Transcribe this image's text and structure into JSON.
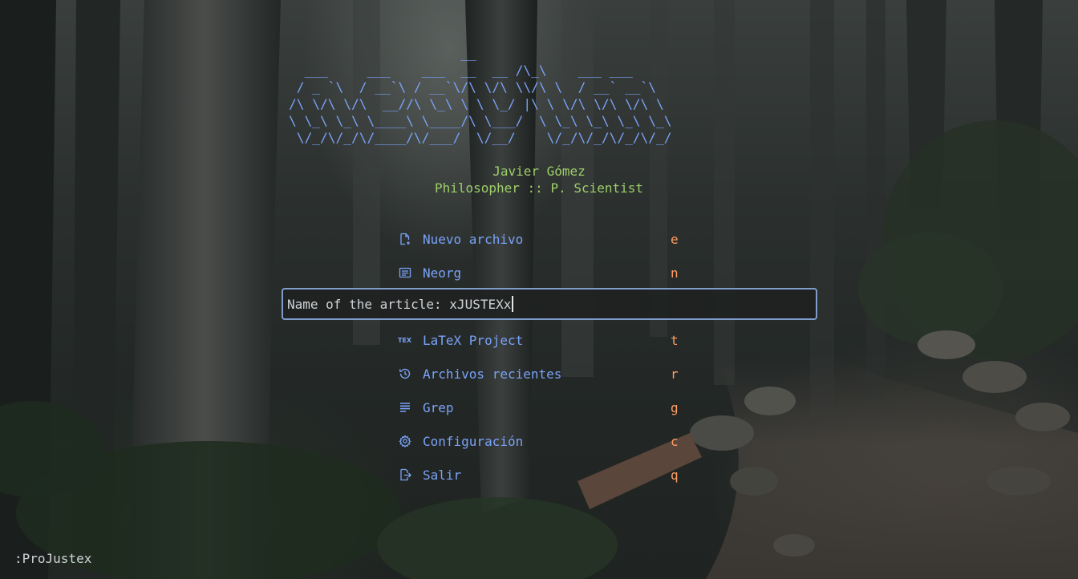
{
  "banner": {
    "art": "                      __\n  ___     ___    ___  __  __ /\\_\\    ___ ___\n / _ `\\  / __`\\ / __`\\/\\ \\/\\ \\\\/\\ \\  / __` __`\\\n/\\ \\/\\ \\/\\  __//\\ \\_\\ \\ \\ \\_/ |\\ \\ \\/\\ \\/\\ \\/\\ \\\n\\ \\_\\ \\_\\ \\____\\ \\____/\\ \\___/  \\ \\_\\ \\_\\ \\_\\ \\_\\\n \\/_/\\/_/\\/____/\\/___/  \\/__/    \\/_/\\/_/\\/_/\\/_/"
  },
  "header": {
    "name": "Javier Gómez",
    "subtitle": "Philosopher :: P. Scientist"
  },
  "menu": [
    {
      "label": "Nuevo archivo",
      "key": "e",
      "icon": "new-file-icon"
    },
    {
      "label": "Neorg",
      "key": "n",
      "icon": "note-icon"
    },
    {
      "label": "LaTeX Project",
      "key": "t",
      "icon": "tex-icon"
    },
    {
      "label": "Archivos recientes",
      "key": "r",
      "icon": "history-icon"
    },
    {
      "label": "Grep",
      "key": "g",
      "icon": "text-lines-icon"
    },
    {
      "label": "Configuración",
      "key": "c",
      "icon": "gear-icon"
    },
    {
      "label": "Salir",
      "key": "q",
      "icon": "exit-icon"
    }
  ],
  "prompt": {
    "label": "Name of the article: ",
    "value": "xJUSTEXx"
  },
  "cmdline": {
    "text": ":ProJustex"
  },
  "colors": {
    "banner": "#7aa2f7",
    "header": "#9ece6a",
    "menu_label": "#7aa2f7",
    "menu_key": "#ff9e64",
    "prompt_border": "#7f9ccb"
  }
}
